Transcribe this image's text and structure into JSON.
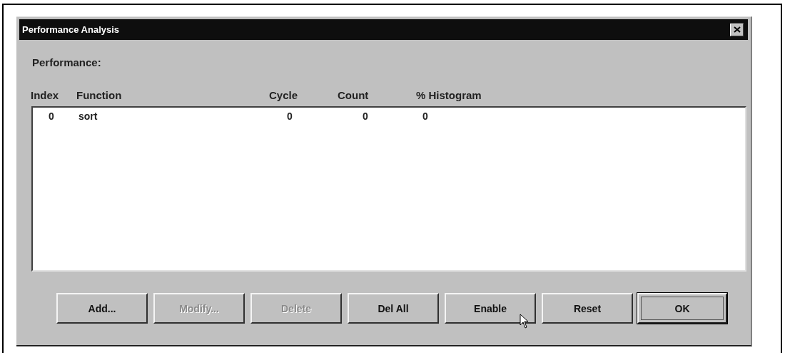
{
  "window": {
    "title": "Performance Analysis"
  },
  "group_label": "Performance:",
  "table": {
    "columns": [
      "Index",
      "Function",
      "Cycle",
      "Count",
      "% Histogram"
    ],
    "rows": [
      [
        "0",
        "sort",
        "0",
        "0",
        "0"
      ]
    ]
  },
  "buttons": [
    {
      "label": "Add...",
      "disabled": false,
      "default": false
    },
    {
      "label": "Modify...",
      "disabled": true,
      "default": false
    },
    {
      "label": "Delete",
      "disabled": true,
      "default": false
    },
    {
      "label": "Del All",
      "disabled": false,
      "default": false
    },
    {
      "label": "Enable",
      "disabled": false,
      "default": false
    },
    {
      "label": "Reset",
      "disabled": false,
      "default": false
    },
    {
      "label": "OK",
      "disabled": false,
      "default": true
    }
  ]
}
